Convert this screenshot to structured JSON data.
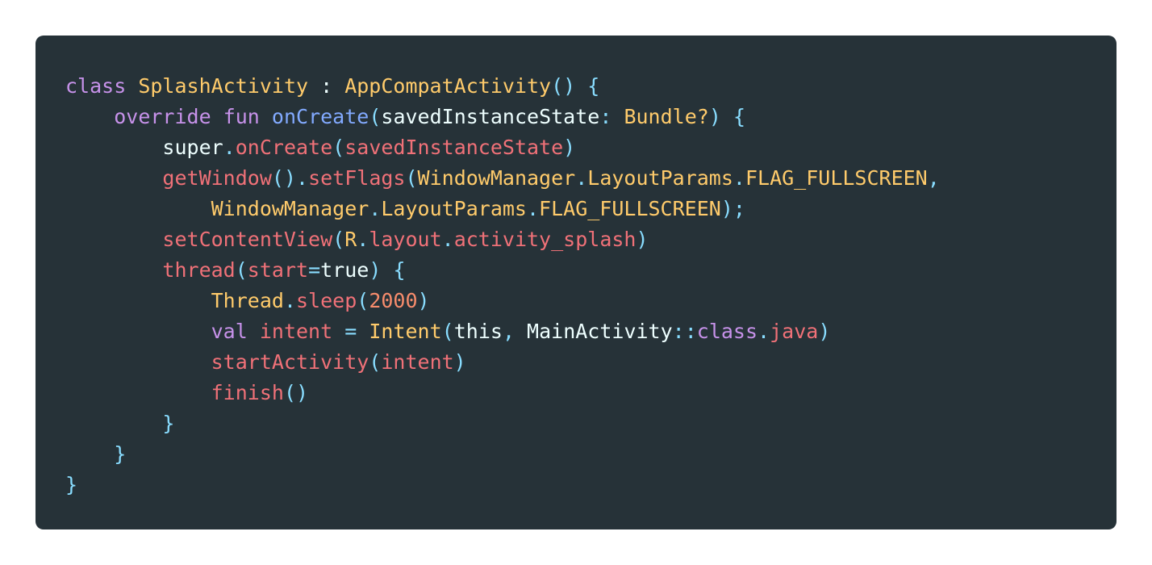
{
  "code_lines": [
    [
      {
        "text": "class",
        "cls": "kw"
      },
      {
        "text": " ",
        "cls": "plain"
      },
      {
        "text": "SplashActivity",
        "cls": "type"
      },
      {
        "text": " : ",
        "cls": "plain"
      },
      {
        "text": "AppCompatActivity",
        "cls": "type"
      },
      {
        "text": "()",
        "cls": "punc"
      },
      {
        "text": " ",
        "cls": "plain"
      },
      {
        "text": "{",
        "cls": "punc"
      }
    ],
    [
      {
        "text": "    ",
        "cls": "plain"
      },
      {
        "text": "override",
        "cls": "kw"
      },
      {
        "text": " ",
        "cls": "plain"
      },
      {
        "text": "fun",
        "cls": "kw"
      },
      {
        "text": " ",
        "cls": "plain"
      },
      {
        "text": "onCreate",
        "cls": "fn"
      },
      {
        "text": "(",
        "cls": "punc"
      },
      {
        "text": "savedInstanceState",
        "cls": "plain"
      },
      {
        "text": ": ",
        "cls": "punc"
      },
      {
        "text": "Bundle?",
        "cls": "type"
      },
      {
        "text": ")",
        "cls": "punc"
      },
      {
        "text": " ",
        "cls": "plain"
      },
      {
        "text": "{",
        "cls": "punc"
      }
    ],
    [
      {
        "text": "        ",
        "cls": "plain"
      },
      {
        "text": "super",
        "cls": "plain"
      },
      {
        "text": ".",
        "cls": "punc"
      },
      {
        "text": "onCreate",
        "cls": "call"
      },
      {
        "text": "(",
        "cls": "punc"
      },
      {
        "text": "savedInstanceState",
        "cls": "call"
      },
      {
        "text": ")",
        "cls": "punc"
      }
    ],
    [
      {
        "text": "        ",
        "cls": "plain"
      },
      {
        "text": "getWindow",
        "cls": "call"
      },
      {
        "text": "()",
        "cls": "punc"
      },
      {
        "text": ".",
        "cls": "punc"
      },
      {
        "text": "setFlags",
        "cls": "call"
      },
      {
        "text": "(",
        "cls": "punc"
      },
      {
        "text": "WindowManager",
        "cls": "type"
      },
      {
        "text": ".",
        "cls": "punc"
      },
      {
        "text": "LayoutParams",
        "cls": "type"
      },
      {
        "text": ".",
        "cls": "punc"
      },
      {
        "text": "FLAG_FULLSCREEN",
        "cls": "type"
      },
      {
        "text": ",",
        "cls": "punc"
      }
    ],
    [
      {
        "text": "            ",
        "cls": "plain"
      },
      {
        "text": "WindowManager",
        "cls": "type"
      },
      {
        "text": ".",
        "cls": "punc"
      },
      {
        "text": "LayoutParams",
        "cls": "type"
      },
      {
        "text": ".",
        "cls": "punc"
      },
      {
        "text": "FLAG_FULLSCREEN",
        "cls": "type"
      },
      {
        "text": ");",
        "cls": "punc"
      }
    ],
    [
      {
        "text": "        ",
        "cls": "plain"
      },
      {
        "text": "setContentView",
        "cls": "call"
      },
      {
        "text": "(",
        "cls": "punc"
      },
      {
        "text": "R",
        "cls": "type"
      },
      {
        "text": ".",
        "cls": "punc"
      },
      {
        "text": "layout",
        "cls": "call"
      },
      {
        "text": ".",
        "cls": "punc"
      },
      {
        "text": "activity_splash",
        "cls": "call"
      },
      {
        "text": ")",
        "cls": "punc"
      }
    ],
    [
      {
        "text": "        ",
        "cls": "plain"
      },
      {
        "text": "thread",
        "cls": "call"
      },
      {
        "text": "(",
        "cls": "punc"
      },
      {
        "text": "start",
        "cls": "call"
      },
      {
        "text": "=",
        "cls": "punc"
      },
      {
        "text": "true",
        "cls": "plain"
      },
      {
        "text": ")",
        "cls": "punc"
      },
      {
        "text": " ",
        "cls": "plain"
      },
      {
        "text": "{",
        "cls": "punc"
      }
    ],
    [
      {
        "text": "            ",
        "cls": "plain"
      },
      {
        "text": "Thread",
        "cls": "type"
      },
      {
        "text": ".",
        "cls": "punc"
      },
      {
        "text": "sleep",
        "cls": "call"
      },
      {
        "text": "(",
        "cls": "punc"
      },
      {
        "text": "2000",
        "cls": "num"
      },
      {
        "text": ")",
        "cls": "punc"
      }
    ],
    [
      {
        "text": "            ",
        "cls": "plain"
      },
      {
        "text": "val",
        "cls": "kw"
      },
      {
        "text": " ",
        "cls": "plain"
      },
      {
        "text": "intent",
        "cls": "call"
      },
      {
        "text": " ",
        "cls": "plain"
      },
      {
        "text": "=",
        "cls": "punc"
      },
      {
        "text": " ",
        "cls": "plain"
      },
      {
        "text": "Intent",
        "cls": "type"
      },
      {
        "text": "(",
        "cls": "punc"
      },
      {
        "text": "this",
        "cls": "plain"
      },
      {
        "text": ", ",
        "cls": "punc"
      },
      {
        "text": "MainActivity",
        "cls": "plain"
      },
      {
        "text": "::",
        "cls": "punc"
      },
      {
        "text": "class",
        "cls": "kw"
      },
      {
        "text": ".",
        "cls": "punc"
      },
      {
        "text": "java",
        "cls": "call"
      },
      {
        "text": ")",
        "cls": "punc"
      }
    ],
    [
      {
        "text": "            ",
        "cls": "plain"
      },
      {
        "text": "startActivity",
        "cls": "call"
      },
      {
        "text": "(",
        "cls": "punc"
      },
      {
        "text": "intent",
        "cls": "call"
      },
      {
        "text": ")",
        "cls": "punc"
      }
    ],
    [
      {
        "text": "            ",
        "cls": "plain"
      },
      {
        "text": "finish",
        "cls": "call"
      },
      {
        "text": "()",
        "cls": "punc"
      }
    ],
    [
      {
        "text": "        ",
        "cls": "plain"
      },
      {
        "text": "}",
        "cls": "punc"
      }
    ],
    [
      {
        "text": "    ",
        "cls": "plain"
      },
      {
        "text": "}",
        "cls": "punc"
      }
    ],
    [
      {
        "text": "}",
        "cls": "punc"
      }
    ]
  ]
}
